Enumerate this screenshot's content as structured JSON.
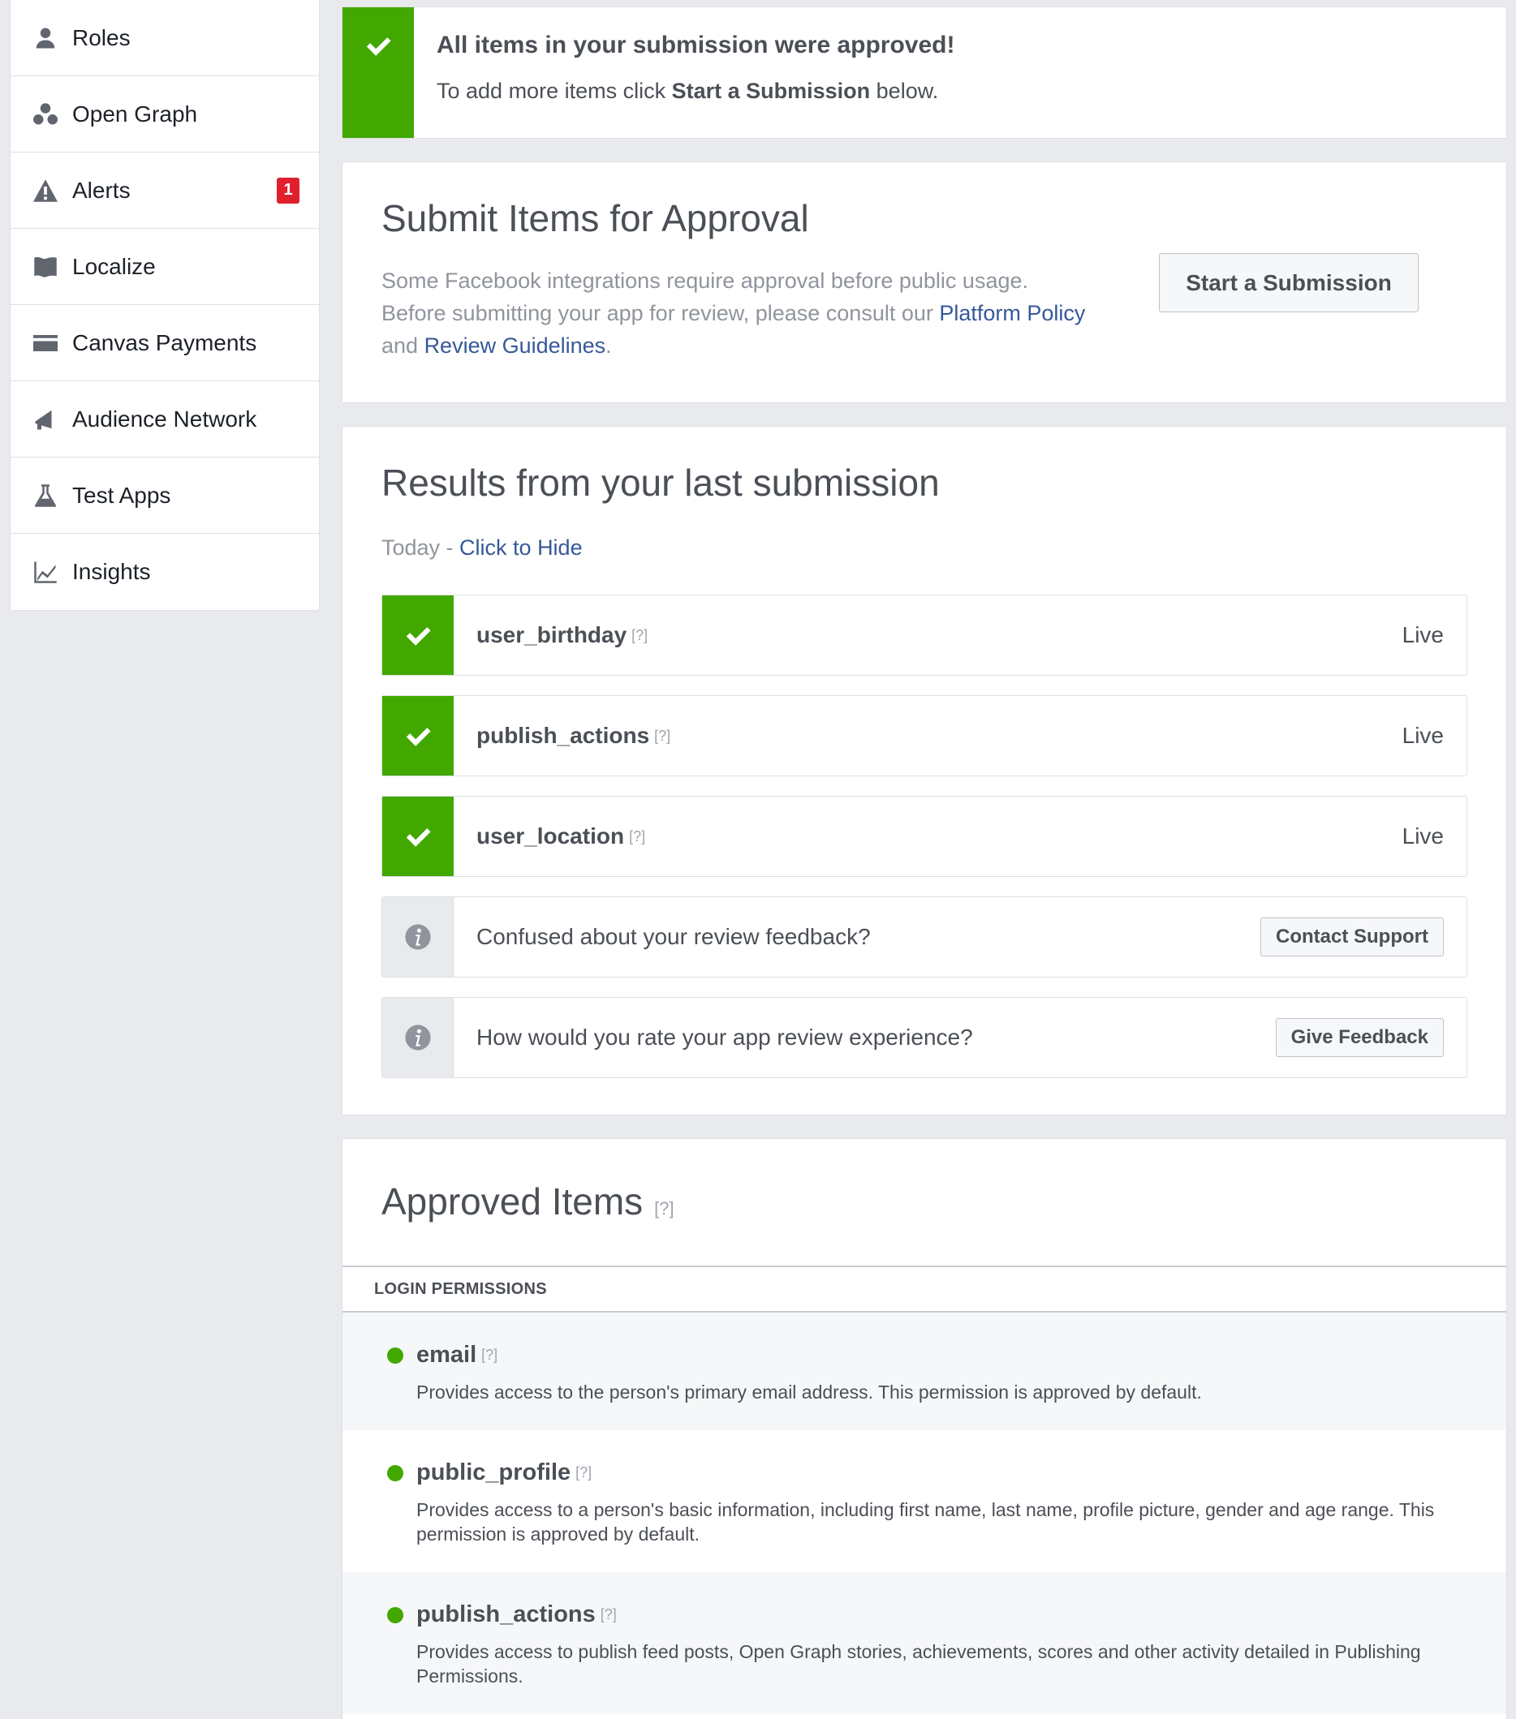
{
  "sidebar": {
    "items": [
      {
        "label": "Roles",
        "icon": "person-icon"
      },
      {
        "label": "Open Graph",
        "icon": "open-graph-icon"
      },
      {
        "label": "Alerts",
        "icon": "warning-icon",
        "badge": "1"
      },
      {
        "label": "Localize",
        "icon": "flag-icon"
      },
      {
        "label": "Canvas Payments",
        "icon": "credit-card-icon"
      },
      {
        "label": "Audience Network",
        "icon": "megaphone-icon"
      },
      {
        "label": "Test Apps",
        "icon": "flask-icon"
      },
      {
        "label": "Insights",
        "icon": "line-chart-icon"
      }
    ]
  },
  "alert": {
    "title": "All items in your submission were approved!",
    "text_before": "To add more items click ",
    "text_bold": "Start a Submission",
    "text_after": " below."
  },
  "submit": {
    "title": "Submit Items for Approval",
    "desc_1": "Some Facebook integrations require approval before public usage. Before submitting your app for review, please consult our ",
    "link_policy": "Platform Policy",
    "desc_and": " and ",
    "link_guidelines": "Review Guidelines",
    "desc_end": ".",
    "button": "Start a Submission"
  },
  "results": {
    "title": "Results from your last submission",
    "date": "Today - ",
    "hide_link": "Click to Hide",
    "items": [
      {
        "name": "user_birthday",
        "help": "[?]",
        "status": "Live"
      },
      {
        "name": "publish_actions",
        "help": "[?]",
        "status": "Live"
      },
      {
        "name": "user_location",
        "help": "[?]",
        "status": "Live"
      }
    ],
    "info_rows": [
      {
        "text": "Confused about your review feedback?",
        "button": "Contact Support"
      },
      {
        "text": "How would you rate your app review experience?",
        "button": "Give Feedback"
      }
    ]
  },
  "approved": {
    "title": "Approved Items",
    "help": "[?]",
    "section": "LOGIN PERMISSIONS",
    "permissions": [
      {
        "name": "email",
        "help": "[?]",
        "desc": "Provides access to the person's primary email address. This permission is approved by default."
      },
      {
        "name": "public_profile",
        "help": "[?]",
        "desc": "Provides access to a person's basic information, including first name, last name, profile picture, gender and age range. This permission is approved by default."
      },
      {
        "name": "publish_actions",
        "help": "[?]",
        "desc": "Provides access to publish feed posts, Open Graph stories, achievements, scores and other activity detailed in Publishing Permissions."
      }
    ]
  },
  "colors": {
    "success_green": "#42a800",
    "link_blue": "#365899",
    "badge_red": "#e0202c",
    "page_bg": "#e9eaed"
  }
}
